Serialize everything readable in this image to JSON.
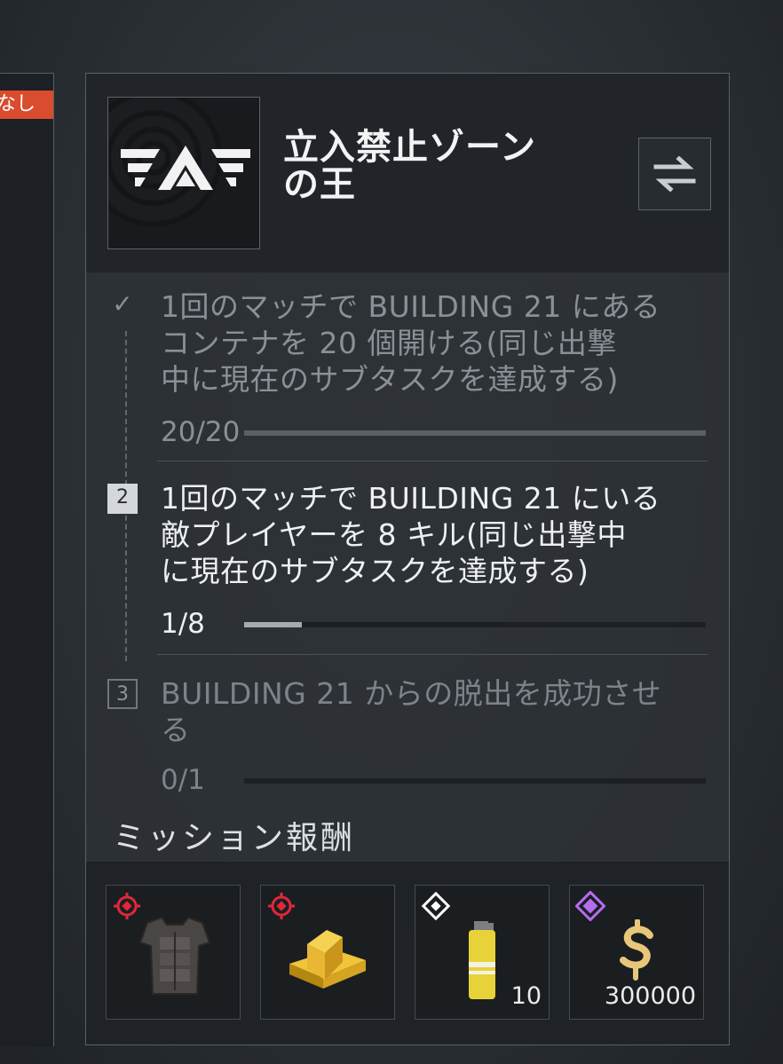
{
  "left_panel": {
    "tag_text": "なし"
  },
  "mission": {
    "title_line1": "立入禁止ゾーン",
    "title_line2": "の王",
    "tasks": [
      {
        "marker": "✓",
        "text_line1": "1回のマッチで BUILDING 21 にある",
        "text_line2": "コンテナを 20 個開ける(同じ出撃",
        "text_line3": "中に現在のサブタスクを達成する)",
        "progress": "20/20",
        "fraction": 1.0,
        "state": "completed"
      },
      {
        "marker": "2",
        "text_line1": "1回のマッチで BUILDING 21 にいる",
        "text_line2": "敵プレイヤーを 8 キル(同じ出撃中",
        "text_line3": "に現在のサブタスクを達成する)",
        "progress": "1/8",
        "fraction": 0.125,
        "state": "active"
      },
      {
        "marker": "3",
        "text_line1": "BUILDING 21 からの脱出を成功させ",
        "text_line2": "る",
        "progress": "0/1",
        "fraction": 0,
        "state": "locked"
      }
    ]
  },
  "rewards": {
    "title": "ミッション報酬",
    "items": [
      {
        "icon": "armor-vest-icon",
        "rarity": "red",
        "count": ""
      },
      {
        "icon": "gold-bars-icon",
        "rarity": "red",
        "count": ""
      },
      {
        "icon": "smoke-grenade-icon",
        "rarity": "white",
        "count": "10"
      },
      {
        "icon": "currency-icon",
        "rarity": "purple",
        "count": "300000"
      }
    ]
  },
  "colors": {
    "accent_red": "#d94c2e",
    "rarity_red": "#c0232b",
    "rarity_white": "#ffffff",
    "rarity_purple": "#8a3fd1"
  }
}
